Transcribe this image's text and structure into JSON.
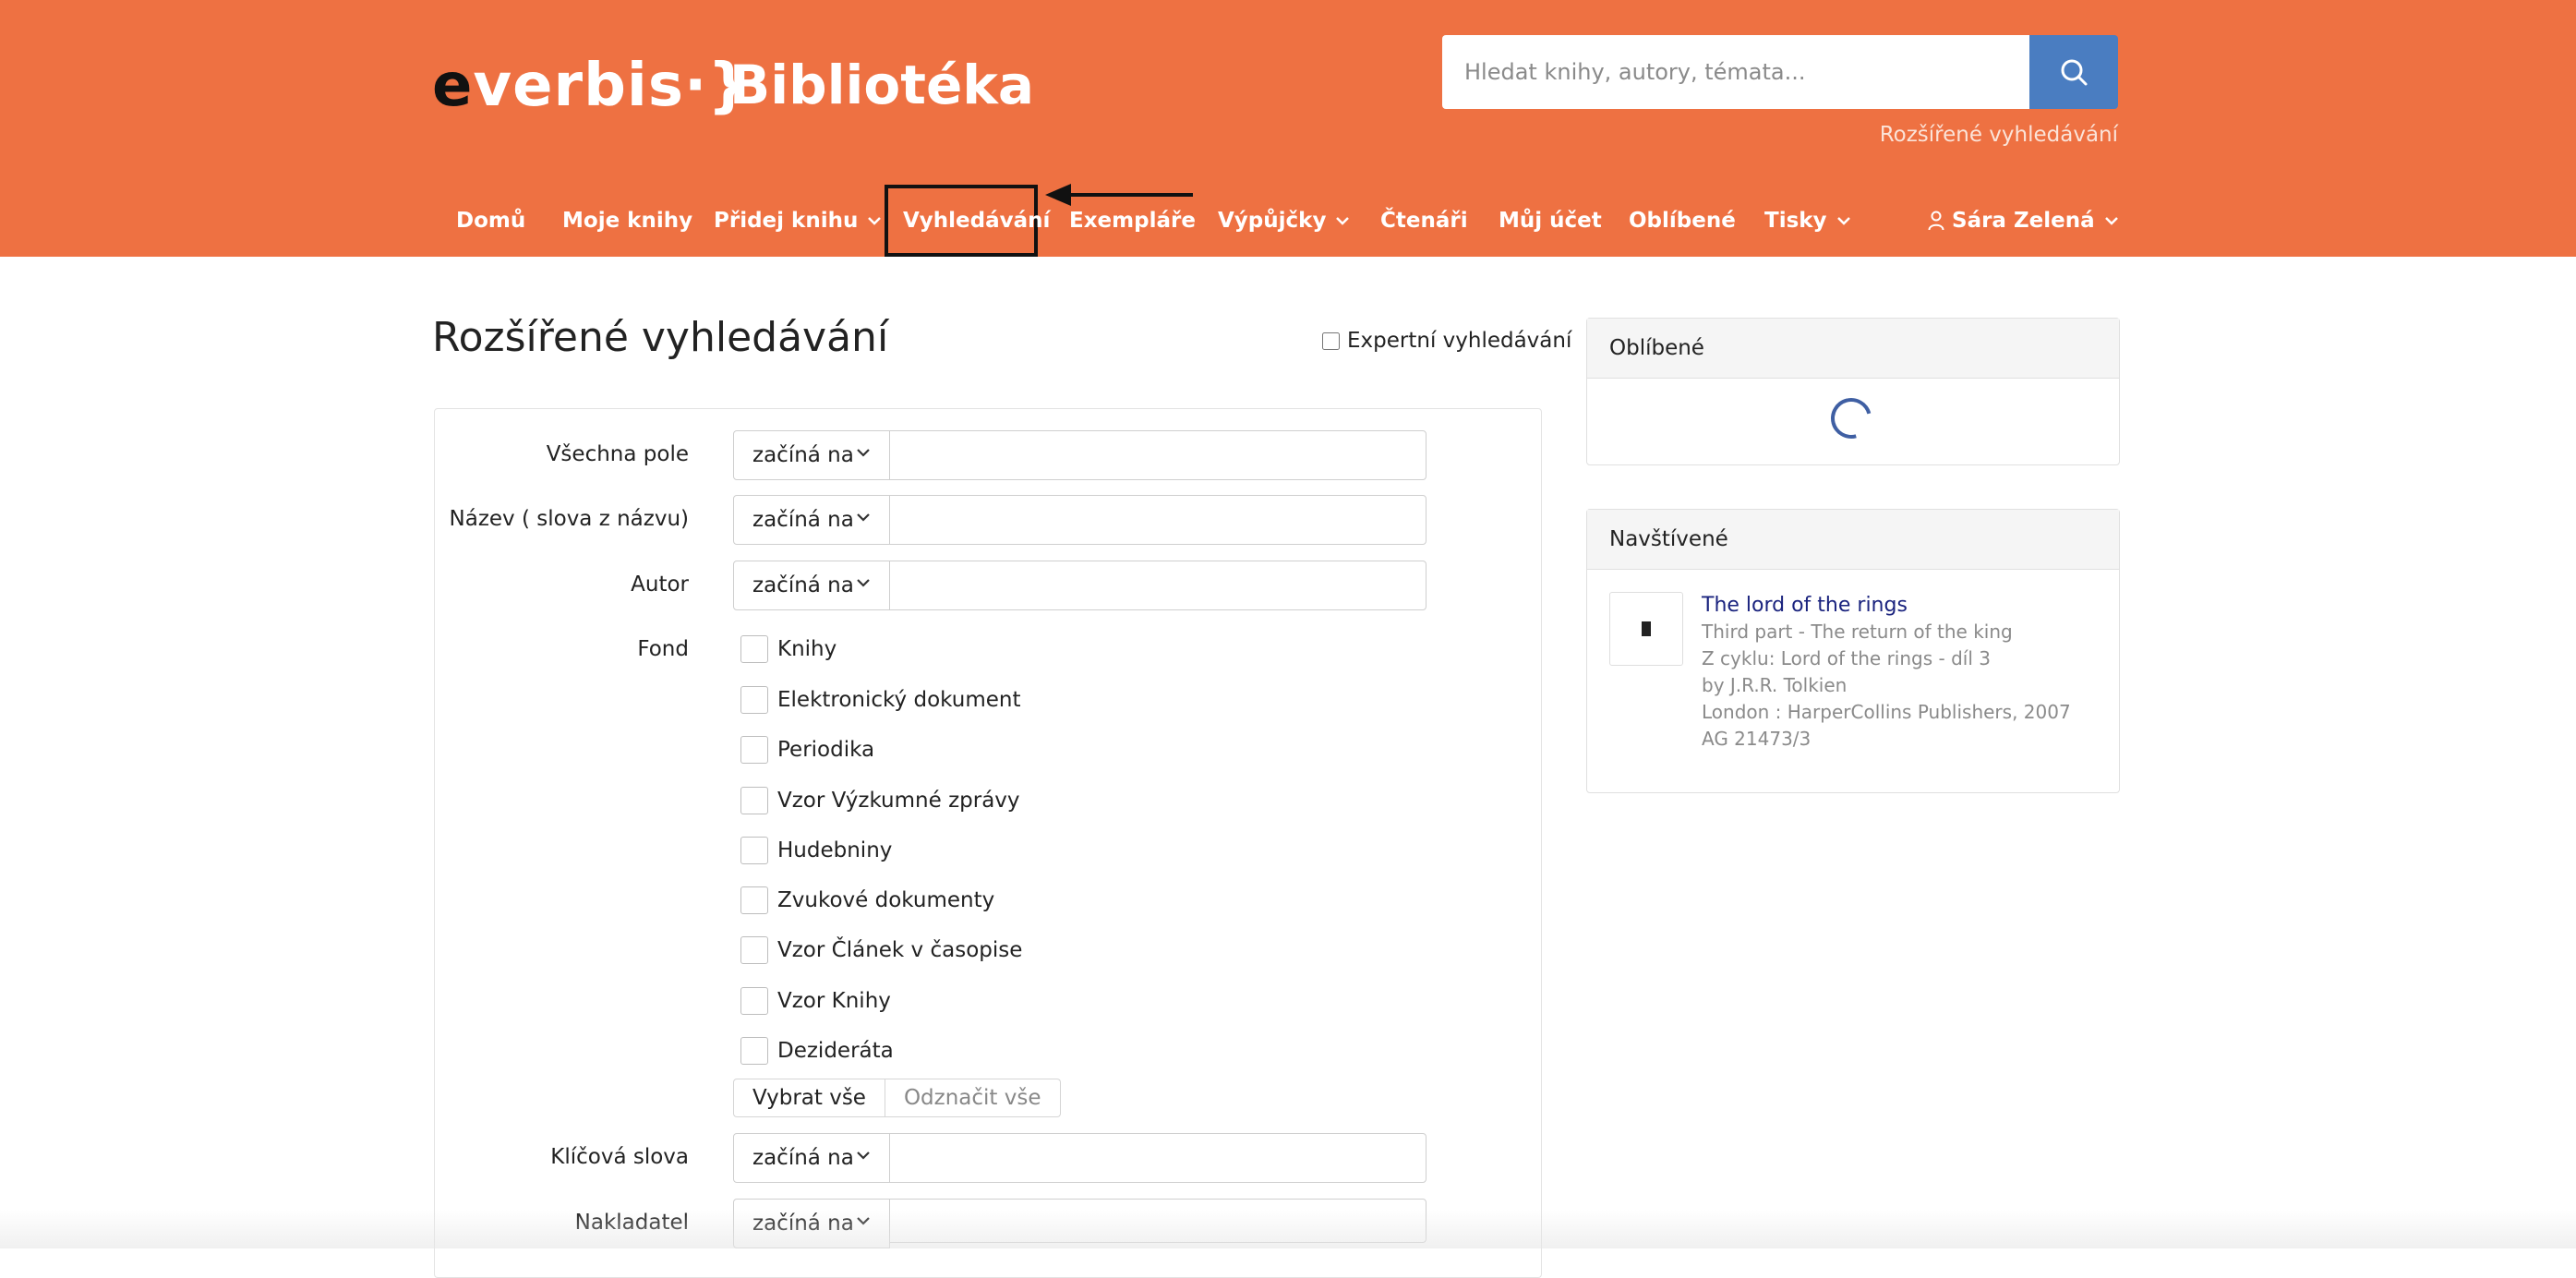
{
  "brand": {
    "logo_e": "e",
    "logo_rest": "verbis",
    "logo_brace": "·}",
    "title": "Bibliotéka"
  },
  "search": {
    "placeholder": "Hledat knihy, autory, témata...",
    "advanced_link": "Rozšířené vyhledávání"
  },
  "nav": {
    "items": [
      {
        "label": "Domů"
      },
      {
        "label": "Moje knihy"
      },
      {
        "label": "Přidej knihu"
      },
      {
        "label": "Vyhledávání"
      },
      {
        "label": "Exempláře"
      },
      {
        "label": "Výpůjčky"
      },
      {
        "label": "Čtenáři"
      },
      {
        "label": "Můj účet"
      },
      {
        "label": "Oblíbené"
      },
      {
        "label": "Tisky"
      }
    ],
    "user": "Sára Zelená",
    "highlighted": "Vyhledávání"
  },
  "page": {
    "title": "Rozšířené vyhledávání",
    "expert_label": "Expertní vyhledávání"
  },
  "form": {
    "fields": [
      {
        "label": "Všechna pole",
        "mode": "začíná na",
        "value": ""
      },
      {
        "label": "Název ( slova z názvu)",
        "mode": "začíná na",
        "value": ""
      },
      {
        "label": "Autor",
        "mode": "začíná na",
        "value": ""
      },
      {
        "label": "Klíčová slova",
        "mode": "začíná na",
        "value": ""
      },
      {
        "label": "Nakladatel",
        "mode": "začíná na",
        "value": ""
      }
    ],
    "fond_label": "Fond",
    "fond_options": [
      "Knihy",
      "Elektronický dokument",
      "Periodika",
      "Vzor Výzkumné zprávy",
      "Hudebniny",
      "Zvukové dokumenty",
      "Vzor Článek v časopise",
      "Vzor Knihy",
      "Dezideráta"
    ],
    "select_all": "Vybrat vše",
    "deselect_all": "Odznačit vše"
  },
  "sidebar": {
    "favorites_title": "Oblíbené",
    "visited_title": "Navštívené",
    "visited_book": {
      "title": "The lord of the rings",
      "subtitle": "Third part - The return of the king",
      "series": "Z cyklu: Lord of the rings - díl 3",
      "author": "by J.R.R. Tolkien",
      "publisher": "London : HarperCollins Publishers, 2007",
      "signature": "AG 21473/3"
    }
  },
  "colors": {
    "header": "#ee7142",
    "search_button": "#4a7dc1",
    "link": "#1a237e"
  }
}
